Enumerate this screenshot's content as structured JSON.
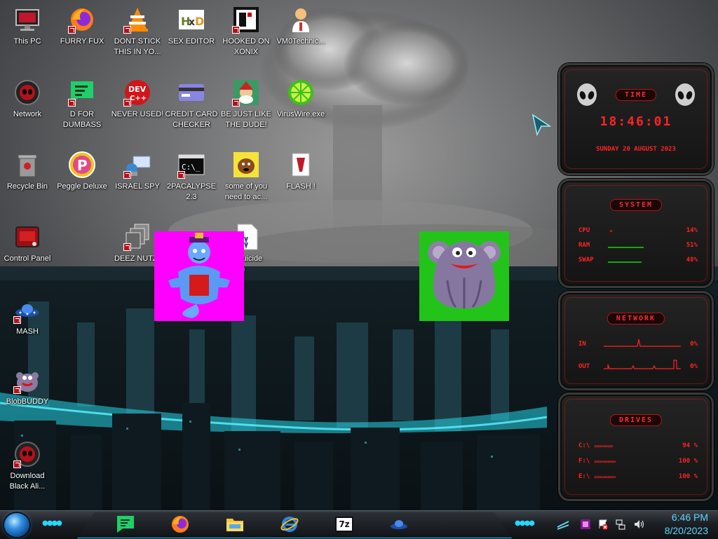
{
  "desktop": {
    "icons": [
      {
        "label": "This PC",
        "icon": "monitor-icon"
      },
      {
        "label": "FURRY FUX",
        "icon": "firefox-icon"
      },
      {
        "label": "DONT STICK THIS IN YO...",
        "icon": "vlc-cone-icon"
      },
      {
        "label": "SEX EDITOR",
        "icon": "hxd-icon"
      },
      {
        "label": "HOOKED ON XONIX",
        "icon": "xonix-icon"
      },
      {
        "label": "VM0Technic...",
        "icon": "doctor-icon"
      },
      {
        "label": "Network",
        "icon": "alien-network-icon"
      },
      {
        "label": "D FOR DUMBASS",
        "icon": "green-chat-icon"
      },
      {
        "label": "NEVER USED!",
        "icon": "devcpp-icon"
      },
      {
        "label": "CREDIT CARD CHECKER",
        "icon": "credit-card-icon"
      },
      {
        "label": "BE JUST LIKE THE DUDE!",
        "icon": "elf-icon"
      },
      {
        "label": "VirusWire.exe",
        "icon": "lime-icon"
      },
      {
        "label": "Recycle Bin",
        "icon": "recycle-bin-icon"
      },
      {
        "label": "Peggle Deluxe",
        "icon": "peggle-icon"
      },
      {
        "label": "ISRAEL SPY",
        "icon": "spy-computer-icon"
      },
      {
        "label": "2PACALYPSE 2.3",
        "icon": "terminal-icon"
      },
      {
        "label": "some of you need to ac...",
        "icon": "dog-icon"
      },
      {
        "label": "FLASH !",
        "icon": "flash-doc-icon"
      },
      {
        "label": "Control Panel",
        "icon": "control-panel-icon"
      },
      {
        "label": "DEEZ NUTZ",
        "icon": "stacked-windows-icon"
      },
      {
        "label": "suicide m",
        "icon": "document-icon"
      },
      {
        "label": "MASH",
        "icon": "ufo-icon"
      },
      {
        "label": "BlobBUDDY",
        "icon": "blob-icon"
      },
      {
        "label": "Download Black Ali...",
        "icon": "alien-download-icon"
      }
    ]
  },
  "widgets": {
    "time": {
      "title": "TIME",
      "clock": "18:46:01",
      "date": "SUNDAY 20 AUGUST 2023"
    },
    "system": {
      "title": "SYSTEM",
      "rows": [
        {
          "label": "CPU",
          "value": "14%",
          "level": 0.14
        },
        {
          "label": "RAM",
          "value": "51%",
          "level": 0.51
        },
        {
          "label": "SWAP",
          "value": "48%",
          "level": 0.48
        }
      ]
    },
    "network": {
      "title": "NETWORK",
      "rows": [
        {
          "label": "IN",
          "value": "0%"
        },
        {
          "label": "OUT",
          "value": "0%"
        }
      ]
    },
    "drives": {
      "title": "DRIVES",
      "rows": [
        {
          "label": "C:\\",
          "value": "94 %",
          "level": 0.94
        },
        {
          "label": "F:\\",
          "value": "100 %",
          "level": 1.0
        },
        {
          "label": "E:\\",
          "value": "100 %",
          "level": 1.0
        }
      ]
    }
  },
  "taskbar": {
    "apps": [
      {
        "name": "green-chat-app",
        "icon": "green-chat-icon"
      },
      {
        "name": "firefox-app",
        "icon": "firefox-icon"
      },
      {
        "name": "file-explorer-app",
        "icon": "folder-icon"
      },
      {
        "name": "internet-explorer-app",
        "icon": "ie-icon"
      },
      {
        "name": "7zip-app",
        "icon": "7zip-icon",
        "text": "7z"
      },
      {
        "name": "mash-app",
        "icon": "ufo-icon"
      }
    ],
    "time": "6:46 PM",
    "date": "8/20/2023"
  },
  "colors": {
    "accent_red": "#ff2323",
    "accent_cyan": "#26d7ff",
    "clock_blue": "#58d8ff"
  }
}
